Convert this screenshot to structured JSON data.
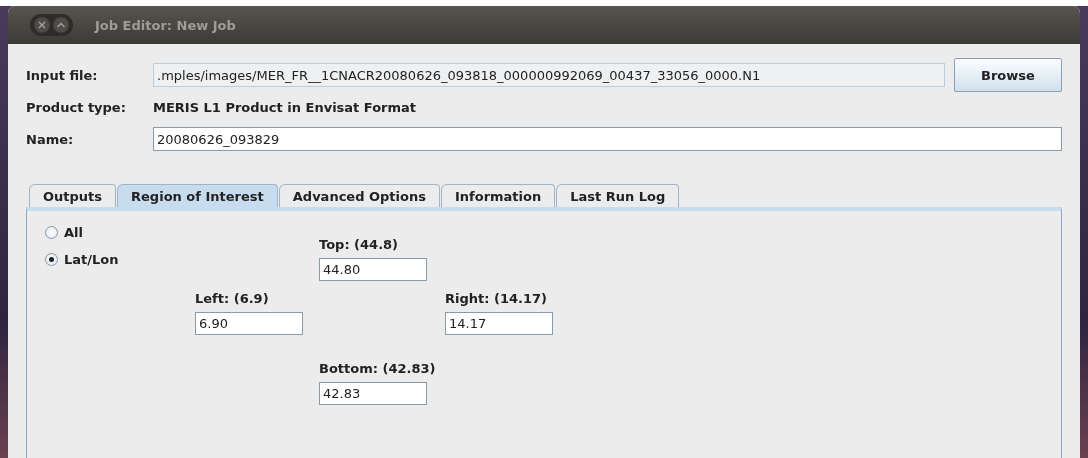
{
  "window": {
    "title": "Job Editor: New Job"
  },
  "form": {
    "input_file": {
      "label": "Input file:",
      "value": ".mples/images/MER_FR__1CNACR20080626_093818_000000992069_00437_33056_0000.N1",
      "button": "Browse"
    },
    "product_type": {
      "label": "Product type:",
      "value": "MERIS L1 Product in Envisat Format"
    },
    "name": {
      "label": "Name:",
      "value": "20080626_093829"
    }
  },
  "tabs": [
    {
      "label": "Outputs",
      "selected": false
    },
    {
      "label": "Region of Interest",
      "selected": true
    },
    {
      "label": "Advanced Options",
      "selected": false
    },
    {
      "label": "Information",
      "selected": false
    },
    {
      "label": "Last Run Log",
      "selected": false
    }
  ],
  "region": {
    "options": [
      {
        "label": "All",
        "selected": false
      },
      {
        "label": "Lat/Lon",
        "selected": true
      }
    ],
    "bounds": [
      {
        "kind": "top",
        "label": "Top: (44.8)",
        "value": "44.80"
      },
      {
        "kind": "left",
        "label": "Left: (6.9)",
        "value": "6.90"
      },
      {
        "kind": "right",
        "label": "Right: (14.17)",
        "value": "14.17"
      },
      {
        "kind": "bottom",
        "label": "Bottom: (42.83)",
        "value": "42.83"
      }
    ]
  }
}
